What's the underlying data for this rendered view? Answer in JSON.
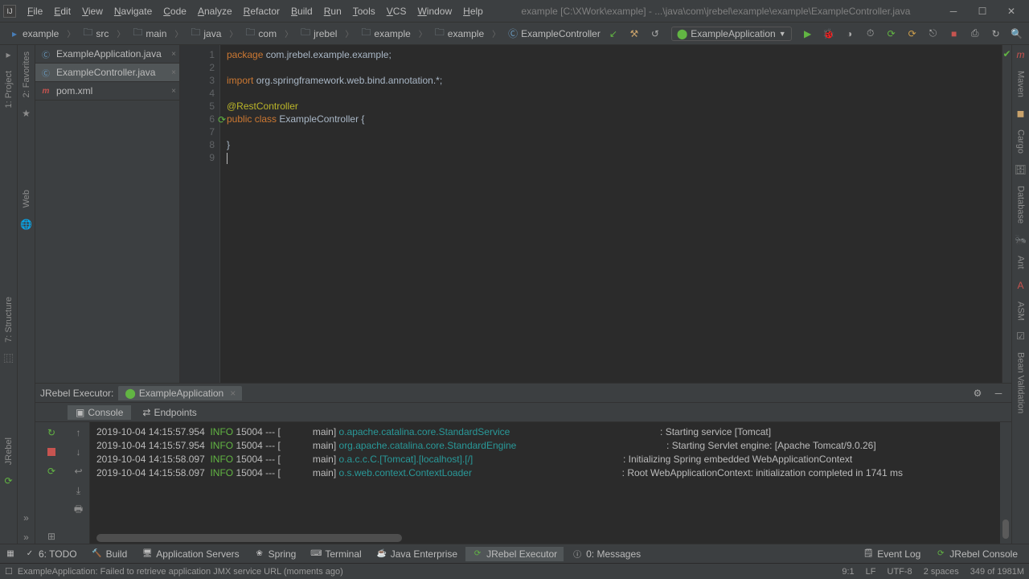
{
  "menu": {
    "items": [
      "File",
      "Edit",
      "View",
      "Navigate",
      "Code",
      "Analyze",
      "Refactor",
      "Build",
      "Run",
      "Tools",
      "VCS",
      "Window",
      "Help"
    ]
  },
  "title": "example [C:\\XWork\\example] - ...\\java\\com\\jrebel\\example\\example\\ExampleController.java",
  "breadcrumb": {
    "items": [
      {
        "label": "example",
        "kind": "module"
      },
      {
        "label": "src",
        "kind": "folder"
      },
      {
        "label": "main",
        "kind": "folder"
      },
      {
        "label": "java",
        "kind": "folder"
      },
      {
        "label": "com",
        "kind": "folder"
      },
      {
        "label": "jrebel",
        "kind": "folder"
      },
      {
        "label": "example",
        "kind": "folder"
      },
      {
        "label": "example",
        "kind": "folder"
      },
      {
        "label": "ExampleController",
        "kind": "class"
      }
    ]
  },
  "run_config": {
    "label": "ExampleApplication"
  },
  "left_strip": {
    "project": "1: Project",
    "structure": "7: Structure",
    "jrebel": "JRebel"
  },
  "left_strip2": {
    "favorites": "2: Favorites",
    "web": "Web"
  },
  "right_strip": {
    "maven": "Maven",
    "cargo": "Cargo",
    "database": "Database",
    "ant": "Ant",
    "asm": "ASM",
    "bean": "Bean Validation"
  },
  "tabs": [
    {
      "label": "ExampleApplication.java",
      "icon": "java"
    },
    {
      "label": "ExampleController.java",
      "icon": "java",
      "active": true
    },
    {
      "label": "pom.xml",
      "icon": "xml"
    }
  ],
  "code": {
    "lines": [
      {
        "n": "1",
        "html": "<span class='kw-orange'>package </span><span class='plain'>com.jrebel.example.example;</span>"
      },
      {
        "n": "2",
        "html": ""
      },
      {
        "n": "3",
        "html": "<span class='kw-orange'>import </span><span class='plain'>org.springframework.web.bind.annotation.*;</span>"
      },
      {
        "n": "4",
        "html": ""
      },
      {
        "n": "5",
        "html": "<span class='kw-yellow'>@RestController</span>"
      },
      {
        "n": "6",
        "html": "<span class='kw-orange'>public class </span><span class='plain'>ExampleController {</span>"
      },
      {
        "n": "7",
        "html": ""
      },
      {
        "n": "8",
        "html": "<span class='plain'>}</span>"
      },
      {
        "n": "9",
        "html": "<span class='cursor'></span>"
      }
    ]
  },
  "executor": {
    "title": "JRebel Executor:",
    "config": "ExampleApplication"
  },
  "console_tabs": {
    "console": "Console",
    "endpoints": "Endpoints"
  },
  "console": {
    "lines": [
      {
        "ts": "2019-10-04 14:15:57.954",
        "lvl": "INFO",
        "pid": "15004",
        "sep": "--- [",
        "thread": "main]",
        "logger": "o.apache.catalina.core.StandardService",
        "msg": ": Starting service [Tomcat]"
      },
      {
        "ts": "2019-10-04 14:15:57.954",
        "lvl": "INFO",
        "pid": "15004",
        "sep": "--- [",
        "thread": "main]",
        "logger": "org.apache.catalina.core.StandardEngine",
        "msg": ": Starting Servlet engine: [Apache Tomcat/9.0.26]"
      },
      {
        "ts": "2019-10-04 14:15:58.097",
        "lvl": "INFO",
        "pid": "15004",
        "sep": "--- [",
        "thread": "main]",
        "logger": "o.a.c.c.C.[Tomcat].[localhost].[/]",
        "msg": ": Initializing Spring embedded WebApplicationContext"
      },
      {
        "ts": "2019-10-04 14:15:58.097",
        "lvl": "INFO",
        "pid": "15004",
        "sep": "--- [",
        "thread": "main]",
        "logger": "o.s.web.context.ContextLoader",
        "msg": ": Root WebApplicationContext: initialization completed in 1741 ms"
      }
    ]
  },
  "bottom_tabs": {
    "left": [
      {
        "label": "6: TODO"
      },
      {
        "label": "Build"
      },
      {
        "label": "Application Servers"
      },
      {
        "label": "Spring"
      },
      {
        "label": "Terminal"
      },
      {
        "label": "Java Enterprise"
      },
      {
        "label": "JRebel Executor",
        "active": true
      },
      {
        "label": "0: Messages"
      }
    ],
    "right": [
      {
        "label": "Event Log"
      },
      {
        "label": "JRebel Console"
      }
    ]
  },
  "status": {
    "msg": "ExampleApplication: Failed to retrieve application JMX service URL (moments ago)",
    "pos": "9:1",
    "le": "LF",
    "enc": "UTF-8",
    "indent": "2 spaces",
    "mem": "349 of 1981M"
  }
}
